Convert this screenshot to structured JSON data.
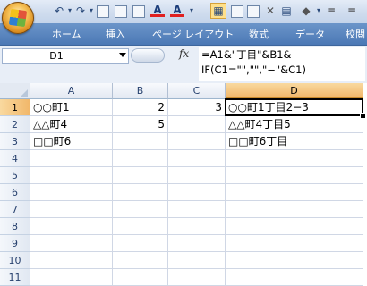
{
  "ribbon": {
    "tabs": [
      "ホーム",
      "挿入",
      "ページ レイアウト",
      "数式",
      "データ",
      "校閲"
    ]
  },
  "qat_icons": [
    "undo-icon",
    "redo-icon",
    "print-preview-icon",
    "save-icon",
    "border-icon",
    "font-color-icon",
    "font-color-icon",
    "table-icon",
    "freeze-icon",
    "clear-icon",
    "cell-styles-icon",
    "fill-color-icon",
    "align-icon"
  ],
  "formula_bar": {
    "name_box": "D1",
    "fx_label": "fx",
    "formula_line1": "=A1&\"丁目\"&B1&",
    "formula_line2": "IF(C1=\"\",\"\",\"−\"&C1)"
  },
  "grid": {
    "columns": [
      "A",
      "B",
      "C",
      "D"
    ],
    "rows": [
      "1",
      "2",
      "3",
      "4",
      "5",
      "6",
      "7",
      "8",
      "9",
      "10",
      "11"
    ],
    "cells": [
      {
        "r": 0,
        "c": 0,
        "v": "○○町1"
      },
      {
        "r": 0,
        "c": 1,
        "v": "2"
      },
      {
        "r": 0,
        "c": 2,
        "v": "3"
      },
      {
        "r": 0,
        "c": 3,
        "v": "○○町1丁目2−3"
      },
      {
        "r": 1,
        "c": 0,
        "v": "△△町4"
      },
      {
        "r": 1,
        "c": 1,
        "v": "5"
      },
      {
        "r": 1,
        "c": 3,
        "v": "△△町4丁目5"
      },
      {
        "r": 2,
        "c": 0,
        "v": "□□町6"
      },
      {
        "r": 2,
        "c": 3,
        "v": "□□町6丁目"
      }
    ],
    "selected_cell": "D1"
  }
}
